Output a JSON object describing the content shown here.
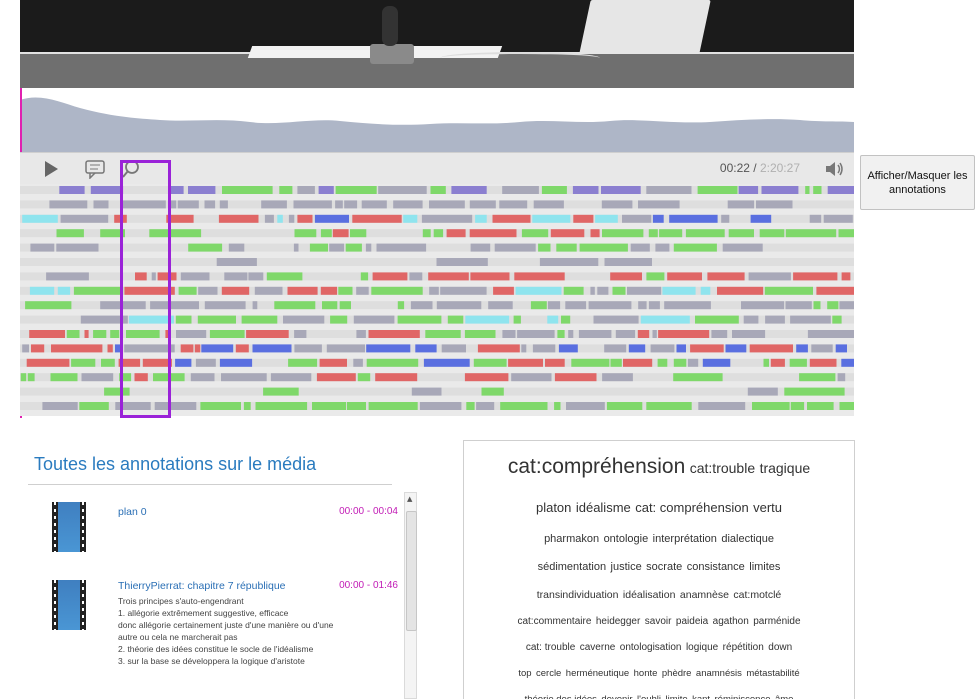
{
  "player": {
    "timecode_current": "00:22",
    "timecode_sep": " / ",
    "timecode_total": "2:20:27"
  },
  "toggle_button": {
    "label": "Afficher/Masquer les annotations"
  },
  "annotations_panel": {
    "title": "Toutes les annotations sur le média",
    "items": [
      {
        "title": "plan 0",
        "time": "00:00 - 00:04",
        "description": ""
      },
      {
        "title": "ThierryPierrat: chapitre 7 république",
        "time": "00:00 - 01:46",
        "description": "Trois principes s'auto-engendrant\n1. allégorie extrêmement suggestive, efficace\ndonc allégorie certainement juste d'une manière ou d'une\nautre ou cela ne marcherait pas\n2. théorie des idées constitue le socle de l'idéalisme\n3. sur la base se développera la logique d'aristote"
      }
    ]
  },
  "tag_cloud": {
    "lines": [
      [
        {
          "text": "cat:compréhension",
          "size": 21
        },
        {
          "text": "cat:trouble",
          "size": 14
        },
        {
          "text": "tragique",
          "size": 14
        }
      ],
      [
        {
          "text": "platon",
          "size": 13
        },
        {
          "text": "idéalisme",
          "size": 13
        },
        {
          "text": "cat: compréhension",
          "size": 13
        },
        {
          "text": "vertu",
          "size": 13
        }
      ],
      [
        {
          "text": "pharmakon",
          "size": 11
        },
        {
          "text": "ontologie",
          "size": 11
        },
        {
          "text": "interprétation",
          "size": 11
        },
        {
          "text": "dialectique",
          "size": 11
        }
      ],
      [
        {
          "text": "sédimentation",
          "size": 11
        },
        {
          "text": "justice",
          "size": 11
        },
        {
          "text": "socrate",
          "size": 11
        },
        {
          "text": "consistance",
          "size": 11
        },
        {
          "text": "limites",
          "size": 11
        }
      ],
      [
        {
          "text": "transindividuation",
          "size": 10.5
        },
        {
          "text": "idéalisation",
          "size": 10.5
        },
        {
          "text": "anamnèse",
          "size": 10.5
        },
        {
          "text": "cat:motclé",
          "size": 10.5
        }
      ],
      [
        {
          "text": "cat:commentaire",
          "size": 10
        },
        {
          "text": "heidegger",
          "size": 10
        },
        {
          "text": "savoir",
          "size": 10
        },
        {
          "text": "paideia",
          "size": 10
        },
        {
          "text": "agathon",
          "size": 10
        },
        {
          "text": "parménide",
          "size": 10
        }
      ],
      [
        {
          "text": "cat: trouble",
          "size": 10
        },
        {
          "text": "caverne",
          "size": 10
        },
        {
          "text": "ontologisation",
          "size": 10
        },
        {
          "text": "logique",
          "size": 10
        },
        {
          "text": "répétition",
          "size": 10
        },
        {
          "text": "down",
          "size": 10
        }
      ],
      [
        {
          "text": "top",
          "size": 9.5
        },
        {
          "text": "cercle",
          "size": 9.5
        },
        {
          "text": "herméneutique",
          "size": 9.5
        },
        {
          "text": "honte",
          "size": 9.5
        },
        {
          "text": "phèdre",
          "size": 9.5
        },
        {
          "text": "anamnésis",
          "size": 9.5
        },
        {
          "text": "métastabilité",
          "size": 9.5
        }
      ],
      [
        {
          "text": "théorie des idées",
          "size": 9.5
        },
        {
          "text": "devenir",
          "size": 9.5
        },
        {
          "text": "l'oubli",
          "size": 9.5
        },
        {
          "text": "limite",
          "size": 9.5
        },
        {
          "text": "kant",
          "size": 9.5
        },
        {
          "text": "réminiscence",
          "size": 9.5
        },
        {
          "text": "âme",
          "size": 9.5
        }
      ]
    ]
  },
  "icons": {
    "play": "play-icon",
    "annotate": "comment-icon",
    "search": "search-icon",
    "volume": "volume-icon"
  },
  "colors": {
    "green": "#7fd86a",
    "gray": "#a8a8b8",
    "purple": "#8b7fd0",
    "red": "#e06666",
    "cyan": "#8fe4ee",
    "blue": "#5a6fe0",
    "highlight": "#9a22d8",
    "title_blue": "#2a7bbf",
    "time_magenta": "#c21cb6"
  }
}
